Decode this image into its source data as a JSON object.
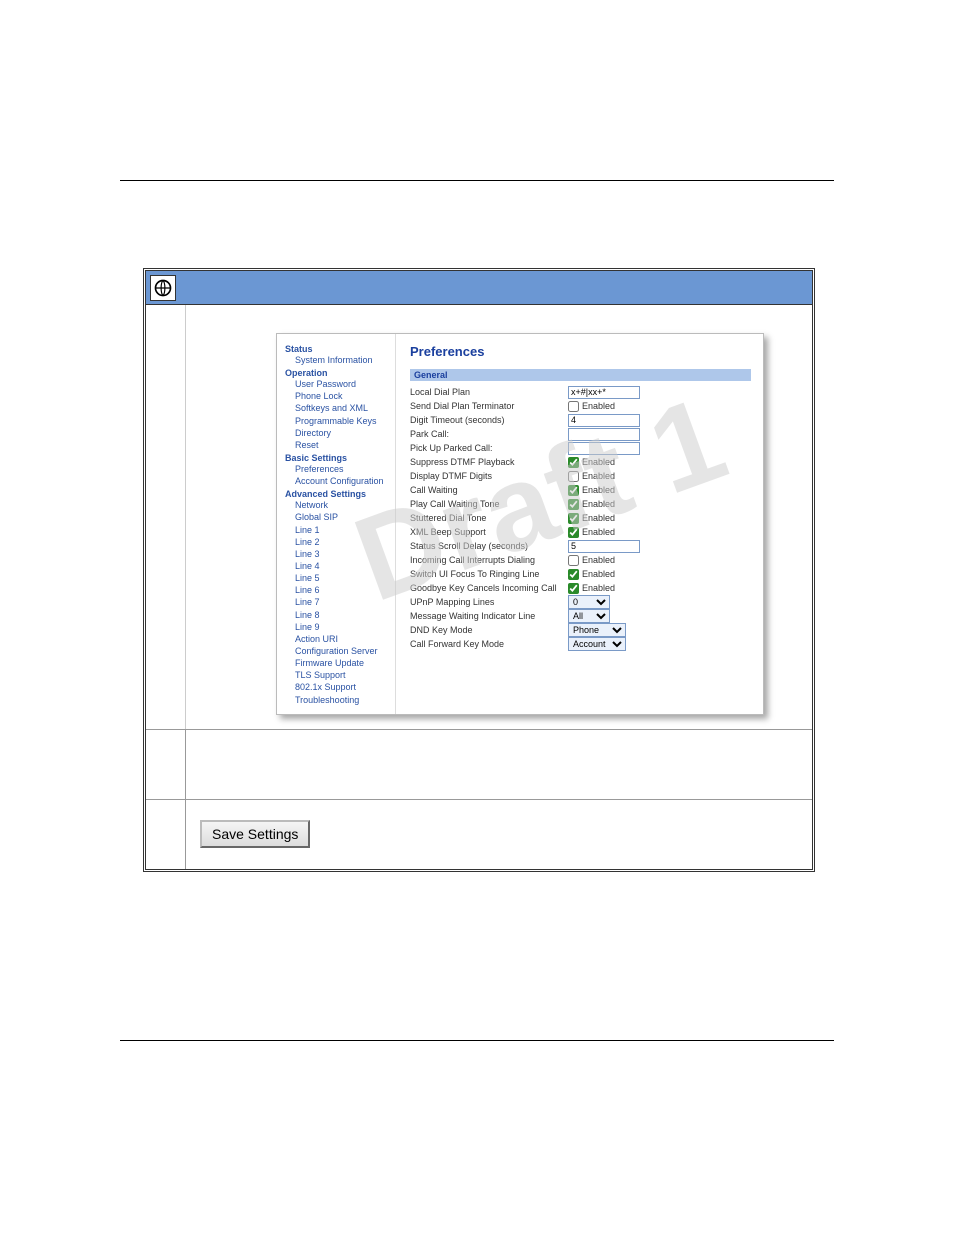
{
  "watermark": "Draft 1",
  "nav": {
    "status": {
      "header": "Status",
      "items": [
        "System Information"
      ]
    },
    "operation": {
      "header": "Operation",
      "items": [
        "User Password",
        "Phone Lock",
        "Softkeys and XML",
        "Programmable Keys",
        "Directory",
        "Reset"
      ]
    },
    "basic": {
      "header": "Basic Settings",
      "items": [
        "Preferences",
        "Account Configuration"
      ]
    },
    "advanced": {
      "header": "Advanced Settings",
      "items": [
        "Network",
        "Global SIP",
        "Line 1",
        "Line 2",
        "Line 3",
        "Line 4",
        "Line 5",
        "Line 6",
        "Line 7",
        "Line 8",
        "Line 9",
        "Action URI",
        "Configuration Server",
        "Firmware Update",
        "TLS Support",
        "802.1x Support",
        "Troubleshooting"
      ]
    }
  },
  "content": {
    "title": "Preferences",
    "section": "General",
    "rows": {
      "local_dial_plan_label": "Local Dial Plan",
      "local_dial_plan_value": "x+#|xx+*",
      "send_terminator_label": "Send Dial Plan Terminator",
      "digit_timeout_label": "Digit Timeout (seconds)",
      "digit_timeout_value": "4",
      "park_call_label": "Park Call:",
      "pickup_label": "Pick Up Parked Call:",
      "suppress_dtmf_label": "Suppress DTMF Playback",
      "display_dtmf_label": "Display DTMF Digits",
      "call_waiting_label": "Call Waiting",
      "play_cw_tone_label": "Play Call Waiting Tone",
      "stuttered_label": "Stuttered Dial Tone",
      "xml_beep_label": "XML Beep Support",
      "status_scroll_label": "Status Scroll Delay (seconds)",
      "status_scroll_value": "5",
      "incoming_interrupt_label": "Incoming Call Interrupts Dialing",
      "switch_ui_label": "Switch UI Focus To Ringing Line",
      "goodbye_label": "Goodbye Key Cancels Incoming Call",
      "upnp_label": "UPnP Mapping Lines",
      "upnp_value": "0",
      "mwi_label": "Message Waiting Indicator Line",
      "mwi_value": "All",
      "dnd_label": "DND Key Mode",
      "dnd_value": "Phone",
      "cf_label": "Call Forward Key Mode",
      "cf_value": "Account",
      "enabled_text": "Enabled"
    }
  },
  "save_button": "Save Settings"
}
